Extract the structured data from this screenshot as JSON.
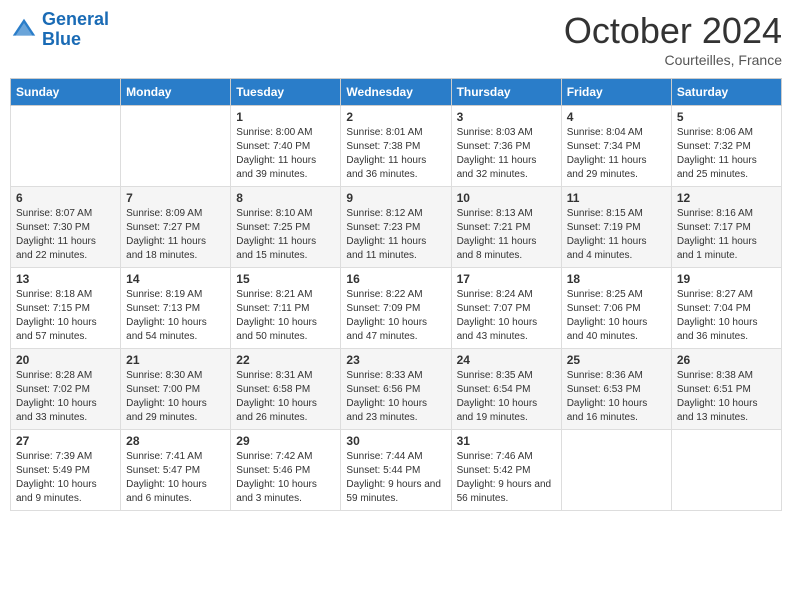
{
  "header": {
    "logo_line1": "General",
    "logo_line2": "Blue",
    "month": "October 2024",
    "location": "Courteilles, France"
  },
  "days_of_week": [
    "Sunday",
    "Monday",
    "Tuesday",
    "Wednesday",
    "Thursday",
    "Friday",
    "Saturday"
  ],
  "weeks": [
    [
      {
        "day": "",
        "sunrise": "",
        "sunset": "",
        "daylight": ""
      },
      {
        "day": "",
        "sunrise": "",
        "sunset": "",
        "daylight": ""
      },
      {
        "day": "1",
        "sunrise": "Sunrise: 8:00 AM",
        "sunset": "Sunset: 7:40 PM",
        "daylight": "Daylight: 11 hours and 39 minutes."
      },
      {
        "day": "2",
        "sunrise": "Sunrise: 8:01 AM",
        "sunset": "Sunset: 7:38 PM",
        "daylight": "Daylight: 11 hours and 36 minutes."
      },
      {
        "day": "3",
        "sunrise": "Sunrise: 8:03 AM",
        "sunset": "Sunset: 7:36 PM",
        "daylight": "Daylight: 11 hours and 32 minutes."
      },
      {
        "day": "4",
        "sunrise": "Sunrise: 8:04 AM",
        "sunset": "Sunset: 7:34 PM",
        "daylight": "Daylight: 11 hours and 29 minutes."
      },
      {
        "day": "5",
        "sunrise": "Sunrise: 8:06 AM",
        "sunset": "Sunset: 7:32 PM",
        "daylight": "Daylight: 11 hours and 25 minutes."
      }
    ],
    [
      {
        "day": "6",
        "sunrise": "Sunrise: 8:07 AM",
        "sunset": "Sunset: 7:30 PM",
        "daylight": "Daylight: 11 hours and 22 minutes."
      },
      {
        "day": "7",
        "sunrise": "Sunrise: 8:09 AM",
        "sunset": "Sunset: 7:27 PM",
        "daylight": "Daylight: 11 hours and 18 minutes."
      },
      {
        "day": "8",
        "sunrise": "Sunrise: 8:10 AM",
        "sunset": "Sunset: 7:25 PM",
        "daylight": "Daylight: 11 hours and 15 minutes."
      },
      {
        "day": "9",
        "sunrise": "Sunrise: 8:12 AM",
        "sunset": "Sunset: 7:23 PM",
        "daylight": "Daylight: 11 hours and 11 minutes."
      },
      {
        "day": "10",
        "sunrise": "Sunrise: 8:13 AM",
        "sunset": "Sunset: 7:21 PM",
        "daylight": "Daylight: 11 hours and 8 minutes."
      },
      {
        "day": "11",
        "sunrise": "Sunrise: 8:15 AM",
        "sunset": "Sunset: 7:19 PM",
        "daylight": "Daylight: 11 hours and 4 minutes."
      },
      {
        "day": "12",
        "sunrise": "Sunrise: 8:16 AM",
        "sunset": "Sunset: 7:17 PM",
        "daylight": "Daylight: 11 hours and 1 minute."
      }
    ],
    [
      {
        "day": "13",
        "sunrise": "Sunrise: 8:18 AM",
        "sunset": "Sunset: 7:15 PM",
        "daylight": "Daylight: 10 hours and 57 minutes."
      },
      {
        "day": "14",
        "sunrise": "Sunrise: 8:19 AM",
        "sunset": "Sunset: 7:13 PM",
        "daylight": "Daylight: 10 hours and 54 minutes."
      },
      {
        "day": "15",
        "sunrise": "Sunrise: 8:21 AM",
        "sunset": "Sunset: 7:11 PM",
        "daylight": "Daylight: 10 hours and 50 minutes."
      },
      {
        "day": "16",
        "sunrise": "Sunrise: 8:22 AM",
        "sunset": "Sunset: 7:09 PM",
        "daylight": "Daylight: 10 hours and 47 minutes."
      },
      {
        "day": "17",
        "sunrise": "Sunrise: 8:24 AM",
        "sunset": "Sunset: 7:07 PM",
        "daylight": "Daylight: 10 hours and 43 minutes."
      },
      {
        "day": "18",
        "sunrise": "Sunrise: 8:25 AM",
        "sunset": "Sunset: 7:06 PM",
        "daylight": "Daylight: 10 hours and 40 minutes."
      },
      {
        "day": "19",
        "sunrise": "Sunrise: 8:27 AM",
        "sunset": "Sunset: 7:04 PM",
        "daylight": "Daylight: 10 hours and 36 minutes."
      }
    ],
    [
      {
        "day": "20",
        "sunrise": "Sunrise: 8:28 AM",
        "sunset": "Sunset: 7:02 PM",
        "daylight": "Daylight: 10 hours and 33 minutes."
      },
      {
        "day": "21",
        "sunrise": "Sunrise: 8:30 AM",
        "sunset": "Sunset: 7:00 PM",
        "daylight": "Daylight: 10 hours and 29 minutes."
      },
      {
        "day": "22",
        "sunrise": "Sunrise: 8:31 AM",
        "sunset": "Sunset: 6:58 PM",
        "daylight": "Daylight: 10 hours and 26 minutes."
      },
      {
        "day": "23",
        "sunrise": "Sunrise: 8:33 AM",
        "sunset": "Sunset: 6:56 PM",
        "daylight": "Daylight: 10 hours and 23 minutes."
      },
      {
        "day": "24",
        "sunrise": "Sunrise: 8:35 AM",
        "sunset": "Sunset: 6:54 PM",
        "daylight": "Daylight: 10 hours and 19 minutes."
      },
      {
        "day": "25",
        "sunrise": "Sunrise: 8:36 AM",
        "sunset": "Sunset: 6:53 PM",
        "daylight": "Daylight: 10 hours and 16 minutes."
      },
      {
        "day": "26",
        "sunrise": "Sunrise: 8:38 AM",
        "sunset": "Sunset: 6:51 PM",
        "daylight": "Daylight: 10 hours and 13 minutes."
      }
    ],
    [
      {
        "day": "27",
        "sunrise": "Sunrise: 7:39 AM",
        "sunset": "Sunset: 5:49 PM",
        "daylight": "Daylight: 10 hours and 9 minutes."
      },
      {
        "day": "28",
        "sunrise": "Sunrise: 7:41 AM",
        "sunset": "Sunset: 5:47 PM",
        "daylight": "Daylight: 10 hours and 6 minutes."
      },
      {
        "day": "29",
        "sunrise": "Sunrise: 7:42 AM",
        "sunset": "Sunset: 5:46 PM",
        "daylight": "Daylight: 10 hours and 3 minutes."
      },
      {
        "day": "30",
        "sunrise": "Sunrise: 7:44 AM",
        "sunset": "Sunset: 5:44 PM",
        "daylight": "Daylight: 9 hours and 59 minutes."
      },
      {
        "day": "31",
        "sunrise": "Sunrise: 7:46 AM",
        "sunset": "Sunset: 5:42 PM",
        "daylight": "Daylight: 9 hours and 56 minutes."
      },
      {
        "day": "",
        "sunrise": "",
        "sunset": "",
        "daylight": ""
      },
      {
        "day": "",
        "sunrise": "",
        "sunset": "",
        "daylight": ""
      }
    ]
  ]
}
